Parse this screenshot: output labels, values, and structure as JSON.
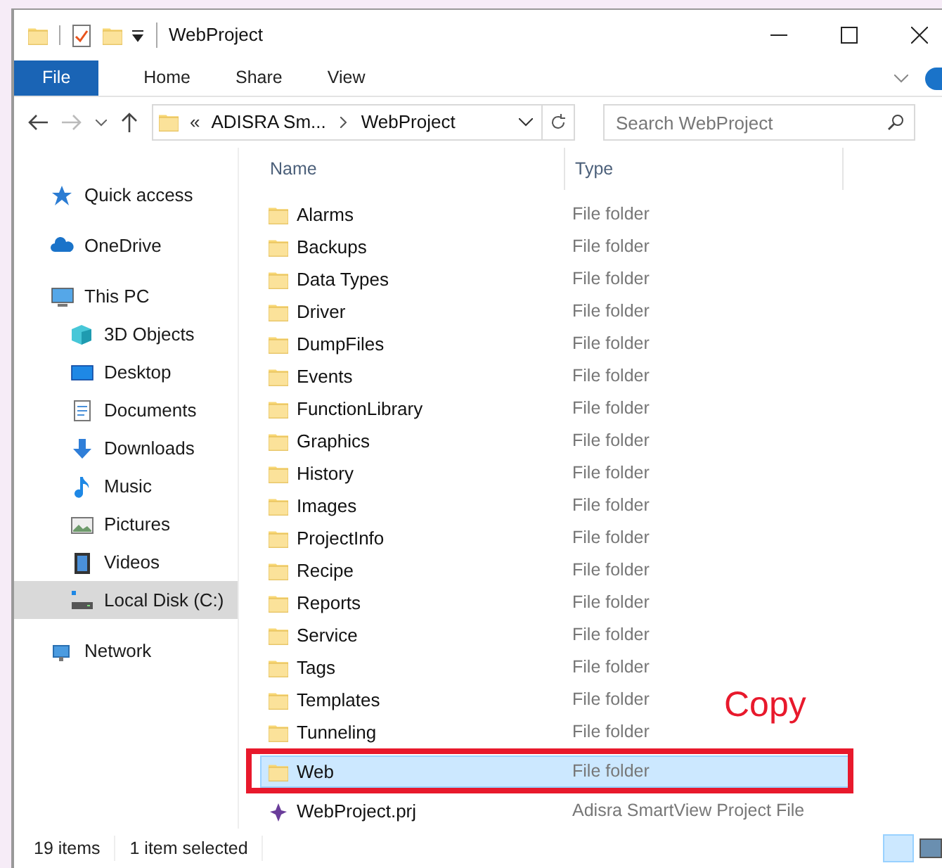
{
  "window": {
    "title": "WebProject"
  },
  "ribbon_tabs": [
    {
      "label": "File",
      "selected": true
    },
    {
      "label": "Home",
      "selected": false
    },
    {
      "label": "Share",
      "selected": false
    },
    {
      "label": "View",
      "selected": false
    }
  ],
  "address_bar": {
    "overflow": "«",
    "crumbs": [
      "ADISRA Sm...",
      "WebProject"
    ]
  },
  "search": {
    "placeholder": "Search WebProject"
  },
  "nav": [
    {
      "label": "Quick access",
      "kind": "star",
      "selected": false
    },
    {
      "label": "OneDrive",
      "kind": "cloud",
      "selected": false
    },
    {
      "label": "This PC",
      "kind": "pc",
      "selected": false,
      "children": [
        {
          "label": "3D Objects",
          "kind": "cube",
          "selected": false
        },
        {
          "label": "Desktop",
          "kind": "desktop",
          "selected": false
        },
        {
          "label": "Documents",
          "kind": "document",
          "selected": false
        },
        {
          "label": "Downloads",
          "kind": "download",
          "selected": false
        },
        {
          "label": "Music",
          "kind": "music",
          "selected": false
        },
        {
          "label": "Pictures",
          "kind": "picture",
          "selected": false
        },
        {
          "label": "Videos",
          "kind": "video",
          "selected": false
        },
        {
          "label": "Local Disk (C:)",
          "kind": "disk",
          "selected": true
        }
      ]
    },
    {
      "label": "Network",
      "kind": "network",
      "selected": false
    }
  ],
  "columns": [
    "Name",
    "Type"
  ],
  "files": [
    {
      "name": "Alarms",
      "type": "File folder",
      "kind": "folder",
      "selected": false
    },
    {
      "name": "Backups",
      "type": "File folder",
      "kind": "folder",
      "selected": false
    },
    {
      "name": "Data Types",
      "type": "File folder",
      "kind": "folder",
      "selected": false
    },
    {
      "name": "Driver",
      "type": "File folder",
      "kind": "folder",
      "selected": false
    },
    {
      "name": "DumpFiles",
      "type": "File folder",
      "kind": "folder",
      "selected": false
    },
    {
      "name": "Events",
      "type": "File folder",
      "kind": "folder",
      "selected": false
    },
    {
      "name": "FunctionLibrary",
      "type": "File folder",
      "kind": "folder",
      "selected": false
    },
    {
      "name": "Graphics",
      "type": "File folder",
      "kind": "folder",
      "selected": false
    },
    {
      "name": "History",
      "type": "File folder",
      "kind": "folder",
      "selected": false
    },
    {
      "name": "Images",
      "type": "File folder",
      "kind": "folder",
      "selected": false
    },
    {
      "name": "ProjectInfo",
      "type": "File folder",
      "kind": "folder",
      "selected": false
    },
    {
      "name": "Recipe",
      "type": "File folder",
      "kind": "folder",
      "selected": false
    },
    {
      "name": "Reports",
      "type": "File folder",
      "kind": "folder",
      "selected": false
    },
    {
      "name": "Service",
      "type": "File folder",
      "kind": "folder",
      "selected": false
    },
    {
      "name": "Tags",
      "type": "File folder",
      "kind": "folder",
      "selected": false
    },
    {
      "name": "Templates",
      "type": "File folder",
      "kind": "folder",
      "selected": false
    },
    {
      "name": "Tunneling",
      "type": "File folder",
      "kind": "folder",
      "selected": false
    },
    {
      "name": "Web",
      "type": "File folder",
      "kind": "folder",
      "selected": true
    },
    {
      "name": "WebProject.prj",
      "type": "Adisra SmartView Project File",
      "kind": "project",
      "selected": false
    }
  ],
  "annotation": {
    "text": "Copy"
  },
  "status_bar": {
    "count": "19 items",
    "selection": "1 item selected"
  }
}
